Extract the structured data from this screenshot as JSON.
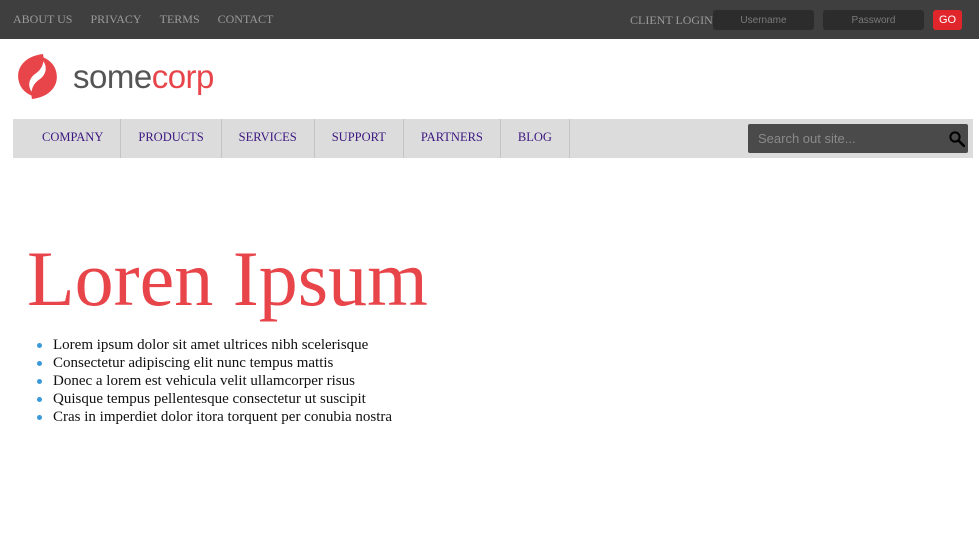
{
  "topbar": {
    "links": [
      "ABOUT US",
      "PRIVACY",
      "TERMS",
      "CONTACT"
    ],
    "client_login_label": "CLIENT LOGIN",
    "username_placeholder": "Username",
    "password_placeholder": "Password",
    "go_label": "GO"
  },
  "logo": {
    "part1": "some",
    "part2": "corp",
    "icon": "swirl-logo-icon"
  },
  "nav": {
    "items": [
      "COMPANY",
      "PRODUCTS",
      "SERVICES",
      "SUPPORT",
      "PARTNERS",
      "BLOG"
    ],
    "search_placeholder": "Search out site...",
    "search_icon": "search-icon"
  },
  "main": {
    "title": "Loren Ipsum",
    "bullets": [
      "Lorem ipsum dolor sit amet ultrices nibh scelerisque",
      "Consectetur adipiscing elit nunc tempus mattis",
      "Donec a lorem est vehicula velit ullamcorper risus",
      "Quisque tempus pellentesque consectetur ut suscipit",
      "Cras in imperdiet dolor itora torquent per conubia nostra"
    ]
  },
  "colors": {
    "accent": "#e8454b",
    "topbar": "#3f3f3f",
    "nav_bg": "#dcdcdc",
    "nav_text": "#3b1680",
    "go_button": "#e0262b",
    "bullet": "#3a9ad9"
  }
}
